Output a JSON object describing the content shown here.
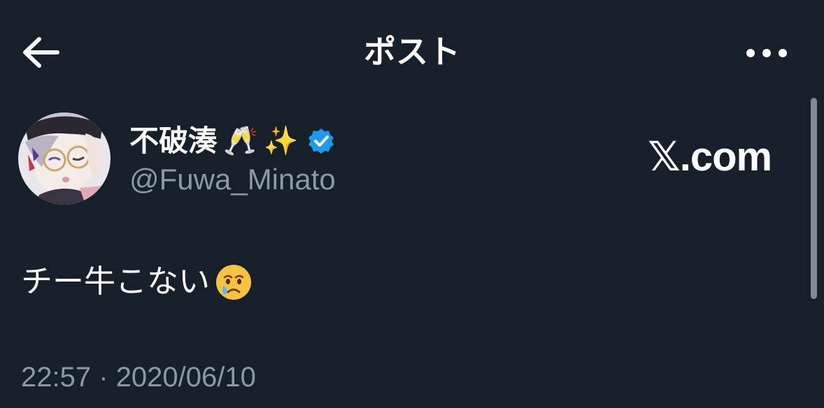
{
  "header": {
    "title": "ポスト",
    "back_icon": "arrow-left-icon",
    "more_icon": "more-dots-icon"
  },
  "author": {
    "display_name": "不破湊",
    "name_emojis": [
      "🥂",
      "✨"
    ],
    "verified_icon": "verified-badge-icon",
    "handle": "@Fuwa_Minato"
  },
  "site_mark": "𝕏.com",
  "tweet": {
    "text": "チー牛こない",
    "emoji_icon": "crying-face-emoji"
  },
  "meta": {
    "time": "22:57",
    "separator": "·",
    "date": "2020/06/10"
  },
  "colors": {
    "background": "#15202b",
    "text": "#ffffff",
    "secondary_text": "#8b98a5",
    "verified_blue": "#1d9bf0"
  }
}
